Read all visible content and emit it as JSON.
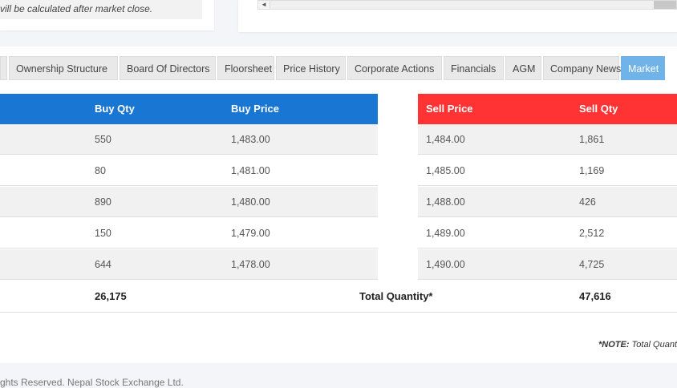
{
  "top_notice": "vill be calculated after market close.",
  "scroll": {
    "left_arrow": "◄"
  },
  "tabs": [
    "Ownership Structure",
    "Board Of Directors",
    "Floorsheet",
    "Price History",
    "Corporate Actions",
    "Financials",
    "AGM",
    "Company News",
    "Market"
  ],
  "active_tab": "Market",
  "buy_header": {
    "qty": "Buy Qty",
    "price": "Buy Price"
  },
  "sell_header": {
    "price": "Sell Price",
    "qty": "Sell Qty"
  },
  "rows": [
    {
      "buy_qty": "550",
      "buy_price": "1,483.00",
      "sell_price": "1,484.00",
      "sell_qty": "1,861"
    },
    {
      "buy_qty": "80",
      "buy_price": "1,481.00",
      "sell_price": "1,485.00",
      "sell_qty": "1,169"
    },
    {
      "buy_qty": "890",
      "buy_price": "1,480.00",
      "sell_price": "1,488.00",
      "sell_qty": "426"
    },
    {
      "buy_qty": "150",
      "buy_price": "1,479.00",
      "sell_price": "1,489.00",
      "sell_qty": "2,512"
    },
    {
      "buy_qty": "644",
      "buy_price": "1,478.00",
      "sell_price": "1,490.00",
      "sell_qty": "4,725"
    }
  ],
  "totals": {
    "buy_qty": "26,175",
    "label": "Total Quantity*",
    "sell_qty": "47,616"
  },
  "note": {
    "prefix": "*NOTE:",
    "text": " Total Quant"
  },
  "footer": "ghts Reserved. Nepal Stock Exchange Ltd.",
  "colors": {
    "buy_header": "#1976d2",
    "sell_header": "#ff3333",
    "active_tab": "#6fb3e8"
  }
}
